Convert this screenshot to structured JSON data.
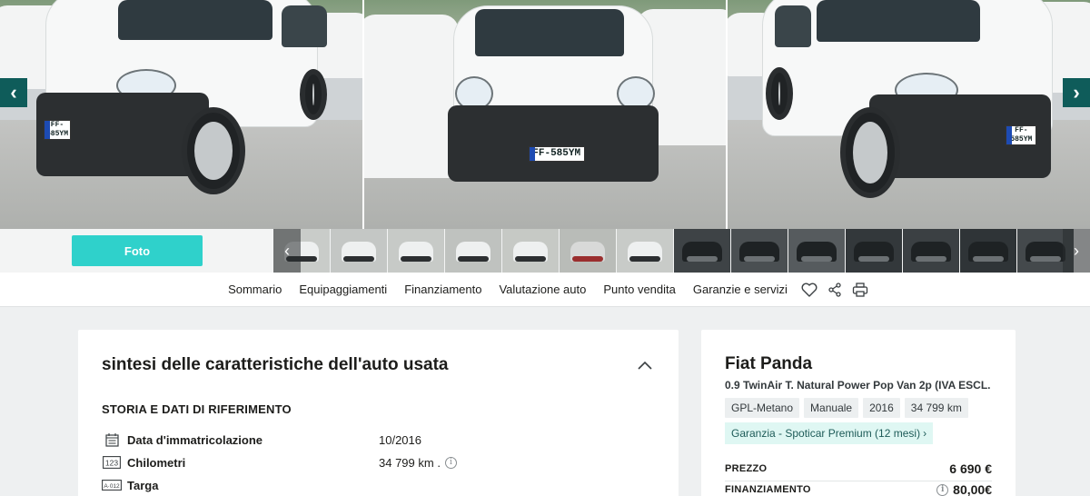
{
  "gallery": {
    "prev_icon": "chevron-left-icon",
    "next_icon": "chevron-right-icon",
    "plates": [
      "FF-585YM",
      "FF-585YM",
      "FF-585YM"
    ]
  },
  "thumbs": {
    "foto_label": "Foto",
    "count": 14
  },
  "subnav": {
    "items": [
      "Sommario",
      "Equipaggiamenti",
      "Finanziamento",
      "Valutazione auto",
      "Punto vendita",
      "Garanzie e servizi"
    ],
    "icons": [
      "heart-icon",
      "share-icon",
      "print-icon"
    ]
  },
  "summary": {
    "title": "sintesi delle caratteristiche dell'auto usata",
    "section_title": "STORIA E DATI DI RIFERIMENTO",
    "rows": [
      {
        "label": "Data d'immatricolazione",
        "value": "10/2016"
      },
      {
        "label": "Chilometri",
        "value": "34 799 km ."
      },
      {
        "label": "Targa",
        "value": ""
      }
    ]
  },
  "vehicle": {
    "name": "Fiat Panda",
    "version": "0.9 TwinAir T. Natural Power Pop Van 2p (IVA ESCL.",
    "chips": [
      "GPL-Metano",
      "Manuale",
      "2016",
      "34 799 km"
    ],
    "warranty": "Garanzia - Spoticar Premium (12 mesi)",
    "price_label": "PREZZO",
    "price_value": "6 690 €",
    "finance_label": "FINANZIAMENTO",
    "finance_value": "80,00€"
  },
  "colors": {
    "accent": "#2fd1cb",
    "gallery_button": "#0f5c5a",
    "warranty_bg": "#dff7f3"
  }
}
